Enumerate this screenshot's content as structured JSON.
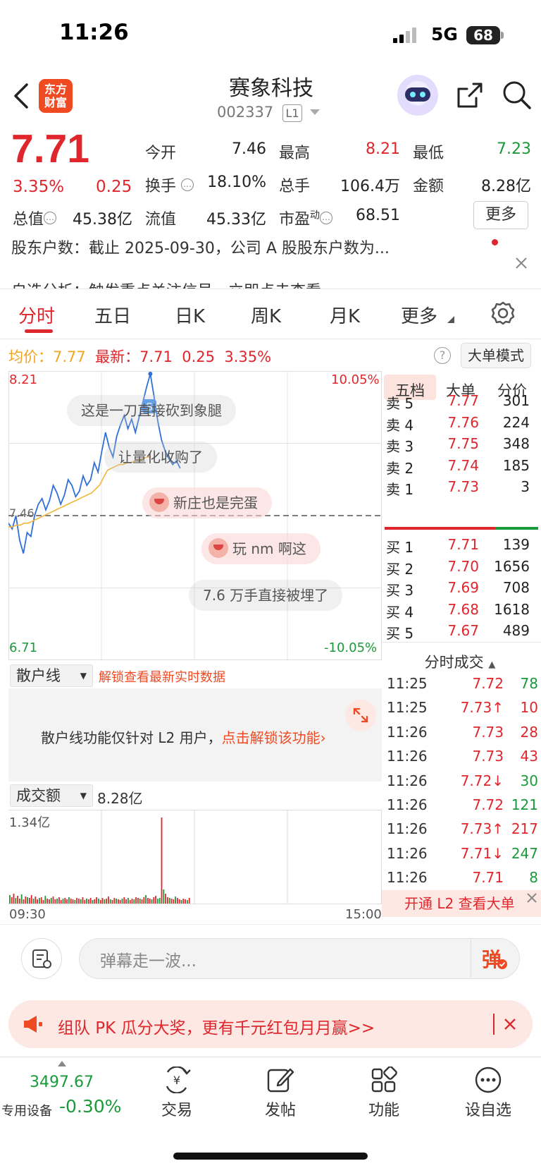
{
  "status": {
    "time": "11:26",
    "network": "5G",
    "battery": "68"
  },
  "header": {
    "logo_line1": "东方",
    "logo_line2": "财富",
    "stock_name": "赛象科技",
    "stock_code": "002337",
    "level": "L1"
  },
  "quote": {
    "price": "7.71",
    "change_pct": "3.35%",
    "change": "0.25",
    "open_label": "今开",
    "open": "7.46",
    "high_label": "最高",
    "high": "8.21",
    "low_label": "最低",
    "low": "7.23",
    "turnover_label": "换手",
    "turnover": "18.10%",
    "volume_label": "总手",
    "volume": "106.4万",
    "amount_label": "金额",
    "amount": "8.28亿",
    "mktcap_label": "总值",
    "mktcap": "45.38亿",
    "float_label": "流值",
    "float_cap": "45.33亿",
    "pe_label": "市盈",
    "pe_sup": "动",
    "pe": "68.51",
    "more": "更多"
  },
  "news": {
    "line1": "股东户数：截止 2025-09-30，公司 A 股股东户数为...",
    "line2": "自选分析：触发重点关注信号，立即点击查看"
  },
  "tabs": [
    "分时",
    "五日",
    "日K",
    "周K",
    "月K",
    "更多"
  ],
  "chart_header": {
    "avg_label": "均价：",
    "avg": "7.77",
    "latest_label": "最新：",
    "latest": "7.71",
    "chg": "0.25",
    "pct": "3.35%",
    "big_order_mode": "大单模式"
  },
  "chart_labels": {
    "top_price": "8.21",
    "bottom_price": "6.71",
    "top_pct": "10.05%",
    "bottom_pct": "-10.05%",
    "mid_price": "7.46"
  },
  "danmu": [
    "这是一刀直接砍到象腿",
    "让量化收购了",
    "新庄也是完蛋",
    "玩 nm 啊这",
    "7.6 万手直接被埋了"
  ],
  "chart_data": {
    "type": "line",
    "x": [
      "09:30",
      "15:00"
    ],
    "ylim": [
      6.71,
      8.21
    ],
    "prev_close": 7.46,
    "series": [
      {
        "values": [
          7.42,
          7.39,
          7.46,
          7.33,
          7.26,
          7.37,
          7.35,
          7.46,
          7.52,
          7.55,
          7.49,
          7.54,
          7.62,
          7.58,
          7.52,
          7.57,
          7.65,
          7.62,
          7.56,
          7.59,
          7.67,
          7.62,
          7.65,
          7.74,
          7.69,
          7.8,
          7.9,
          7.82,
          7.77,
          7.88,
          7.94,
          7.99,
          7.92,
          7.97,
          7.9,
          7.98,
          8.06,
          8.14,
          8.21,
          8.09,
          7.96,
          7.86,
          7.8,
          7.76,
          7.73,
          7.75,
          7.71
        ]
      },
      {
        "values": [
          7.4,
          7.4,
          7.41,
          7.41,
          7.42,
          7.42,
          7.43,
          7.44,
          7.45,
          7.46,
          7.47,
          7.48,
          7.49,
          7.5,
          7.51,
          7.52,
          7.53,
          7.54,
          7.55,
          7.56,
          7.57,
          7.58,
          7.6,
          7.62,
          7.66,
          7.7,
          7.71,
          7.72,
          7.73,
          7.73,
          7.74,
          7.74,
          7.75,
          7.75,
          7.76,
          7.77,
          7.77
        ]
      }
    ]
  },
  "order_book_tabs": [
    "五档",
    "大单",
    "分价"
  ],
  "asks": [
    {
      "label": "卖 5",
      "price": "7.77",
      "vol": "301"
    },
    {
      "label": "卖 4",
      "price": "7.76",
      "vol": "224"
    },
    {
      "label": "卖 3",
      "price": "7.75",
      "vol": "348"
    },
    {
      "label": "卖 2",
      "price": "7.74",
      "vol": "185"
    },
    {
      "label": "卖 1",
      "price": "7.73",
      "vol": "3"
    }
  ],
  "bids": [
    {
      "label": "买 1",
      "price": "7.71",
      "vol": "139"
    },
    {
      "label": "买 2",
      "price": "7.70",
      "vol": "1656"
    },
    {
      "label": "买 3",
      "price": "7.69",
      "vol": "708"
    },
    {
      "label": "买 4",
      "price": "7.68",
      "vol": "1618"
    },
    {
      "label": "买 5",
      "price": "7.67",
      "vol": "489"
    }
  ],
  "ticks_title": "分时成交",
  "ticks": [
    {
      "time": "11:25",
      "price": "7.72",
      "vol": "78",
      "dir": "",
      "vcolor": "green"
    },
    {
      "time": "11:25",
      "price": "7.73↑",
      "vol": "10",
      "dir": "up",
      "vcolor": "red"
    },
    {
      "time": "11:26",
      "price": "7.73",
      "vol": "28",
      "dir": "",
      "vcolor": "red"
    },
    {
      "time": "11:26",
      "price": "7.73",
      "vol": "43",
      "dir": "",
      "vcolor": "red"
    },
    {
      "time": "11:26",
      "price": "7.72↓",
      "vol": "30",
      "dir": "down",
      "vcolor": "green"
    },
    {
      "time": "11:26",
      "price": "7.72",
      "vol": "121",
      "dir": "",
      "vcolor": "green"
    },
    {
      "time": "11:26",
      "price": "7.73↑",
      "vol": "217",
      "dir": "up",
      "vcolor": "red"
    },
    {
      "time": "11:26",
      "price": "7.71↓",
      "vol": "247",
      "dir": "down",
      "vcolor": "green"
    },
    {
      "time": "11:26",
      "price": "7.71",
      "vol": "8",
      "dir": "",
      "vcolor": "green"
    }
  ],
  "l2_banner": "开通 L2 查看大单",
  "retail": {
    "select": "散户线",
    "unlock_hint": "解锁查看最新实时数据",
    "notice": "散户线功能仅针对 L2 用户，",
    "notice_link": "点击解锁该功能"
  },
  "volume_panel": {
    "select": "成交额",
    "total": "8.28亿",
    "max_label": "1.34亿",
    "start_time": "09:30",
    "end_time": "15:00"
  },
  "comment": {
    "placeholder": "弹幕走一波...",
    "danmu_btn": "弹"
  },
  "promo": {
    "text": "组队 PK 瓜分大奖，更有千元红包月月赢>>"
  },
  "bottom_nav": {
    "index_value": "3497.67",
    "index_label": "专用设备",
    "index_change": "-0.30%",
    "items": [
      "交易",
      "发帖",
      "功能",
      "设自选"
    ]
  }
}
